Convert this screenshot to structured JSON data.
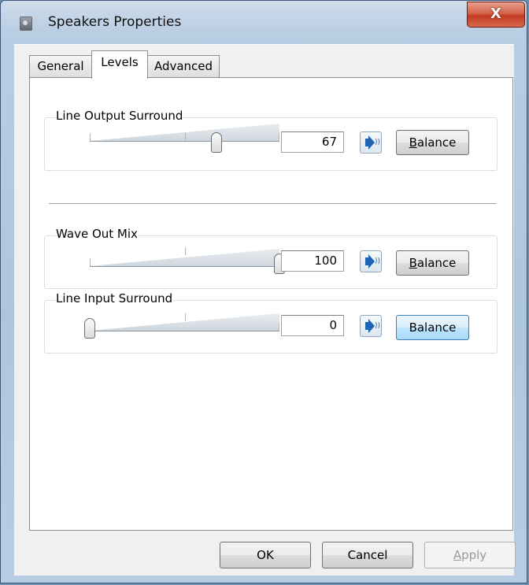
{
  "window": {
    "title": "Speakers Properties",
    "icon": "speaker-properties-icon",
    "close_label": "X"
  },
  "tabs": [
    {
      "label": "General",
      "active": false
    },
    {
      "label": "Levels",
      "active": true
    },
    {
      "label": "Advanced",
      "active": false
    }
  ],
  "levels": [
    {
      "label": "Line Output Surround",
      "value": "67",
      "level_percent": 67,
      "balance_mnemonic": "B",
      "balance_rest": "alance",
      "focused": false
    },
    {
      "label": "Wave Out Mix",
      "value": "100",
      "level_percent": 100,
      "balance_mnemonic": "B",
      "balance_rest": "alance",
      "focused": false
    },
    {
      "label": "Line Input Surround",
      "value": "0",
      "level_percent": 0,
      "balance_mnemonic": "",
      "balance_rest": "Balance",
      "focused": true
    }
  ],
  "footer": {
    "ok_label": "OK",
    "cancel_label": "Cancel",
    "apply_mnemonic": "A",
    "apply_rest": "pply",
    "apply_enabled": false
  },
  "colors": {
    "accent": "#1f63b5",
    "close_red": "#c23a20",
    "frame": "#b9cde3"
  }
}
